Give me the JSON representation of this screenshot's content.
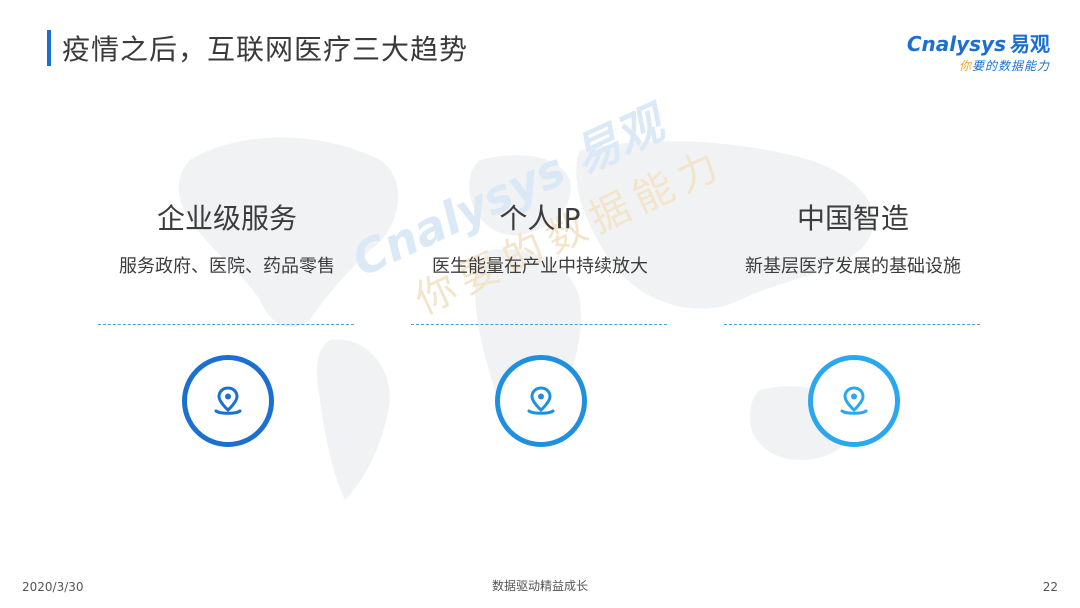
{
  "header": {
    "title": "疫情之后，互联网医疗三大趋势"
  },
  "logo": {
    "brand_en": "Cnalysys",
    "brand_cn": "易观",
    "tagline_first": "你",
    "tagline_rest": "要的数据能力"
  },
  "watermark": {
    "main": "Cnalysys 易观",
    "sub": "你要的数据能力"
  },
  "trends": [
    {
      "title": "企业级服务",
      "description": "服务政府、医院、药品零售",
      "icon": "location-pin-icon",
      "ring_color": "#1a6fd0"
    },
    {
      "title": "个人IP",
      "description": "医生能量在产业中持续放大",
      "icon": "location-pin-icon",
      "ring_color": "#1f8fe0"
    },
    {
      "title": "中国智造",
      "description": "新基层医疗发展的基础设施",
      "icon": "location-pin-icon",
      "ring_color": "#2ba6f0"
    }
  ],
  "footer": {
    "date": "2020/3/30",
    "slogan": "数据驱动精益成长",
    "page": "22"
  },
  "colors": {
    "accent": "#1a6fd0",
    "text": "#3c3c3c"
  }
}
